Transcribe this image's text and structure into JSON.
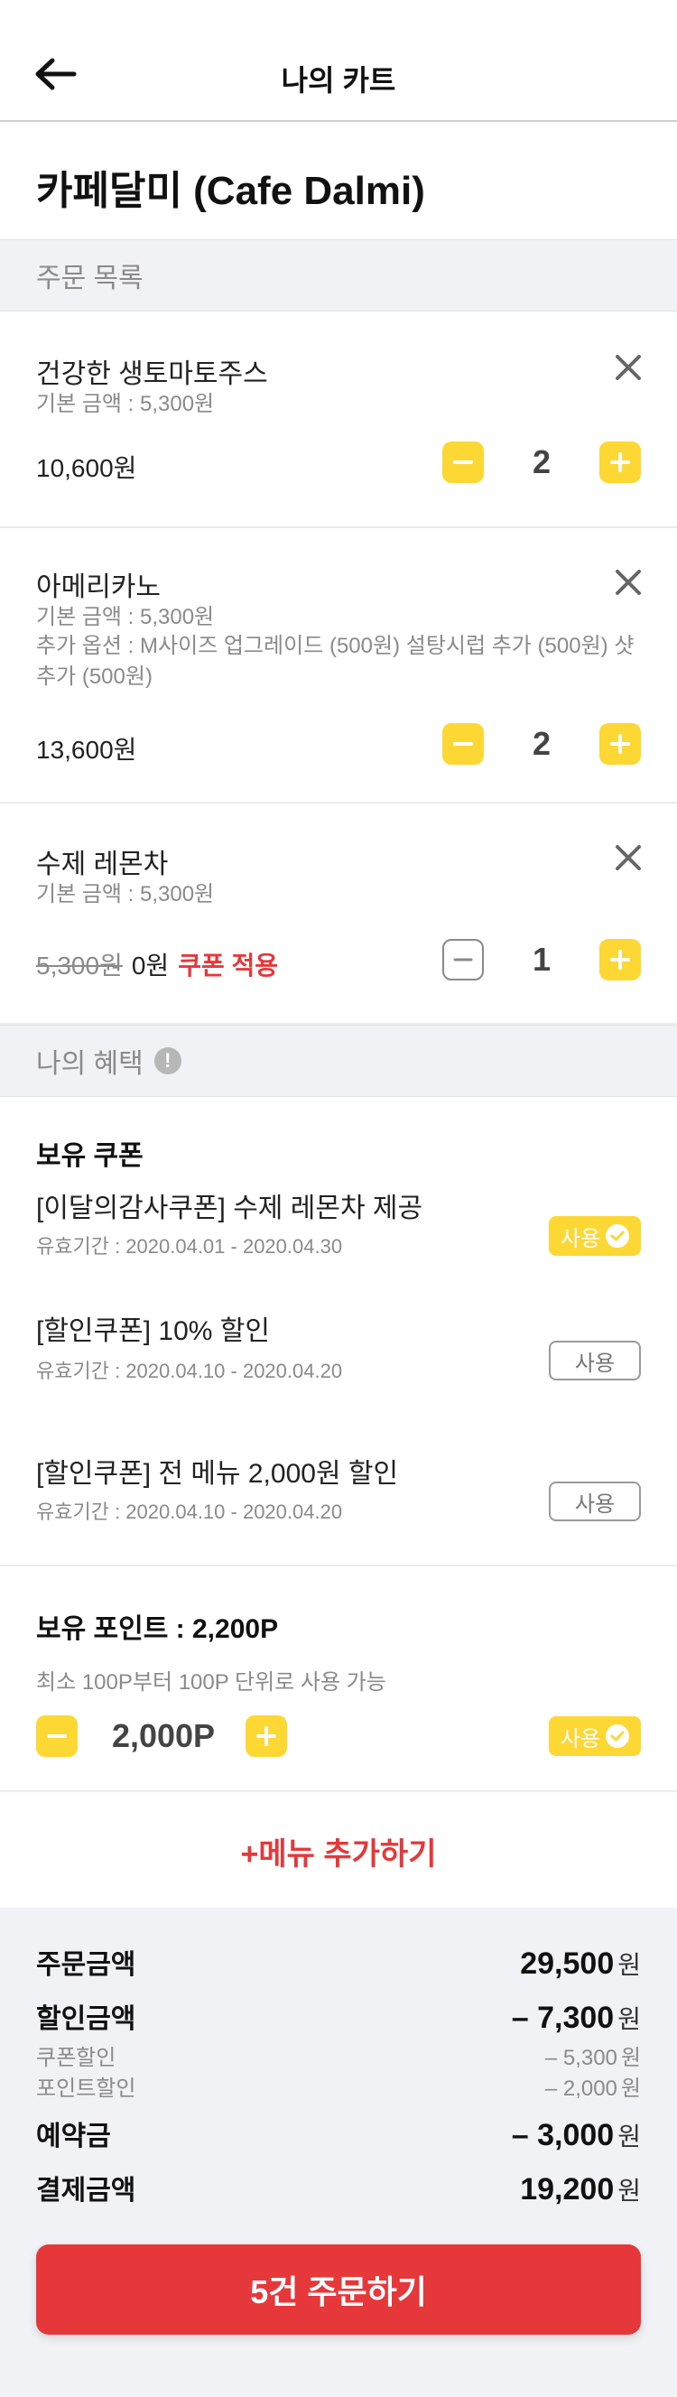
{
  "header": {
    "title": "나의 카트",
    "back_icon": "arrow-left-icon"
  },
  "store": {
    "name": "카페달미 (Cafe Dalmi)"
  },
  "order_list": {
    "section_title": "주문 목록",
    "items": [
      {
        "name": "건강한 생토마토주스",
        "base_price": "기본 금액 : 5,300원",
        "options": "",
        "price": "10,600",
        "price_unit": "원",
        "quantity": "2"
      },
      {
        "name": "아메리카노",
        "base_price": "기본 금액 : 5,300원",
        "options": "추가 옵션 : M사이즈 업그레이드 (500원) 설탕시럽 추가 (500원) 샷추가 (500원)",
        "price": "13,600",
        "price_unit": "원",
        "quantity": "2"
      },
      {
        "name": "수제 레몬차",
        "base_price": "기본 금액 : 5,300원",
        "options": "",
        "original_price": "5,300원",
        "price": "0",
        "price_unit": "원",
        "coupon_applied": "쿠폰 적용",
        "quantity": "1"
      }
    ]
  },
  "benefits": {
    "section_title": "나의 혜택",
    "coupons_title": "보유 쿠폰",
    "coupons": [
      {
        "name": "[이달의감사쿠폰] 수제 레몬차 제공",
        "period": "유효기간 : 2020.04.01 - 2020.04.30",
        "use_label": "사용",
        "selected": true
      },
      {
        "name": "[할인쿠폰] 10% 할인",
        "period": "유효기간 : 2020.04.10 - 2020.04.20",
        "use_label": "사용",
        "selected": false
      },
      {
        "name": "[할인쿠폰] 전 메뉴 2,000원 할인",
        "period": "유효기간 : 2020.04.10 - 2020.04.20",
        "use_label": "사용",
        "selected": false
      }
    ],
    "points": {
      "title": "보유 포인트 : 2,200P",
      "description": "최소 100P부터 100P 단위로 사용 가능",
      "value": "2,000P",
      "use_label": "사용"
    }
  },
  "add_menu_label": "+메뉴 추가하기",
  "summary": {
    "order_amount_label": "주문금액",
    "order_amount": "29,500",
    "discount_label": "할인금액",
    "discount": "– 7,300",
    "coupon_discount_label": "쿠폰할인",
    "coupon_discount": "– 5,300",
    "point_discount_label": "포인트할인",
    "point_discount": "– 2,000",
    "deposit_label": "예약금",
    "deposit": "– 3,000",
    "payment_label": "결제금액",
    "payment": "19,200",
    "unit": "원"
  },
  "order_button_label": "5건 주문하기",
  "colors": {
    "accent_yellow": "#fdd835",
    "accent_red": "#e6383b",
    "section_bg": "#f1f2f6"
  }
}
